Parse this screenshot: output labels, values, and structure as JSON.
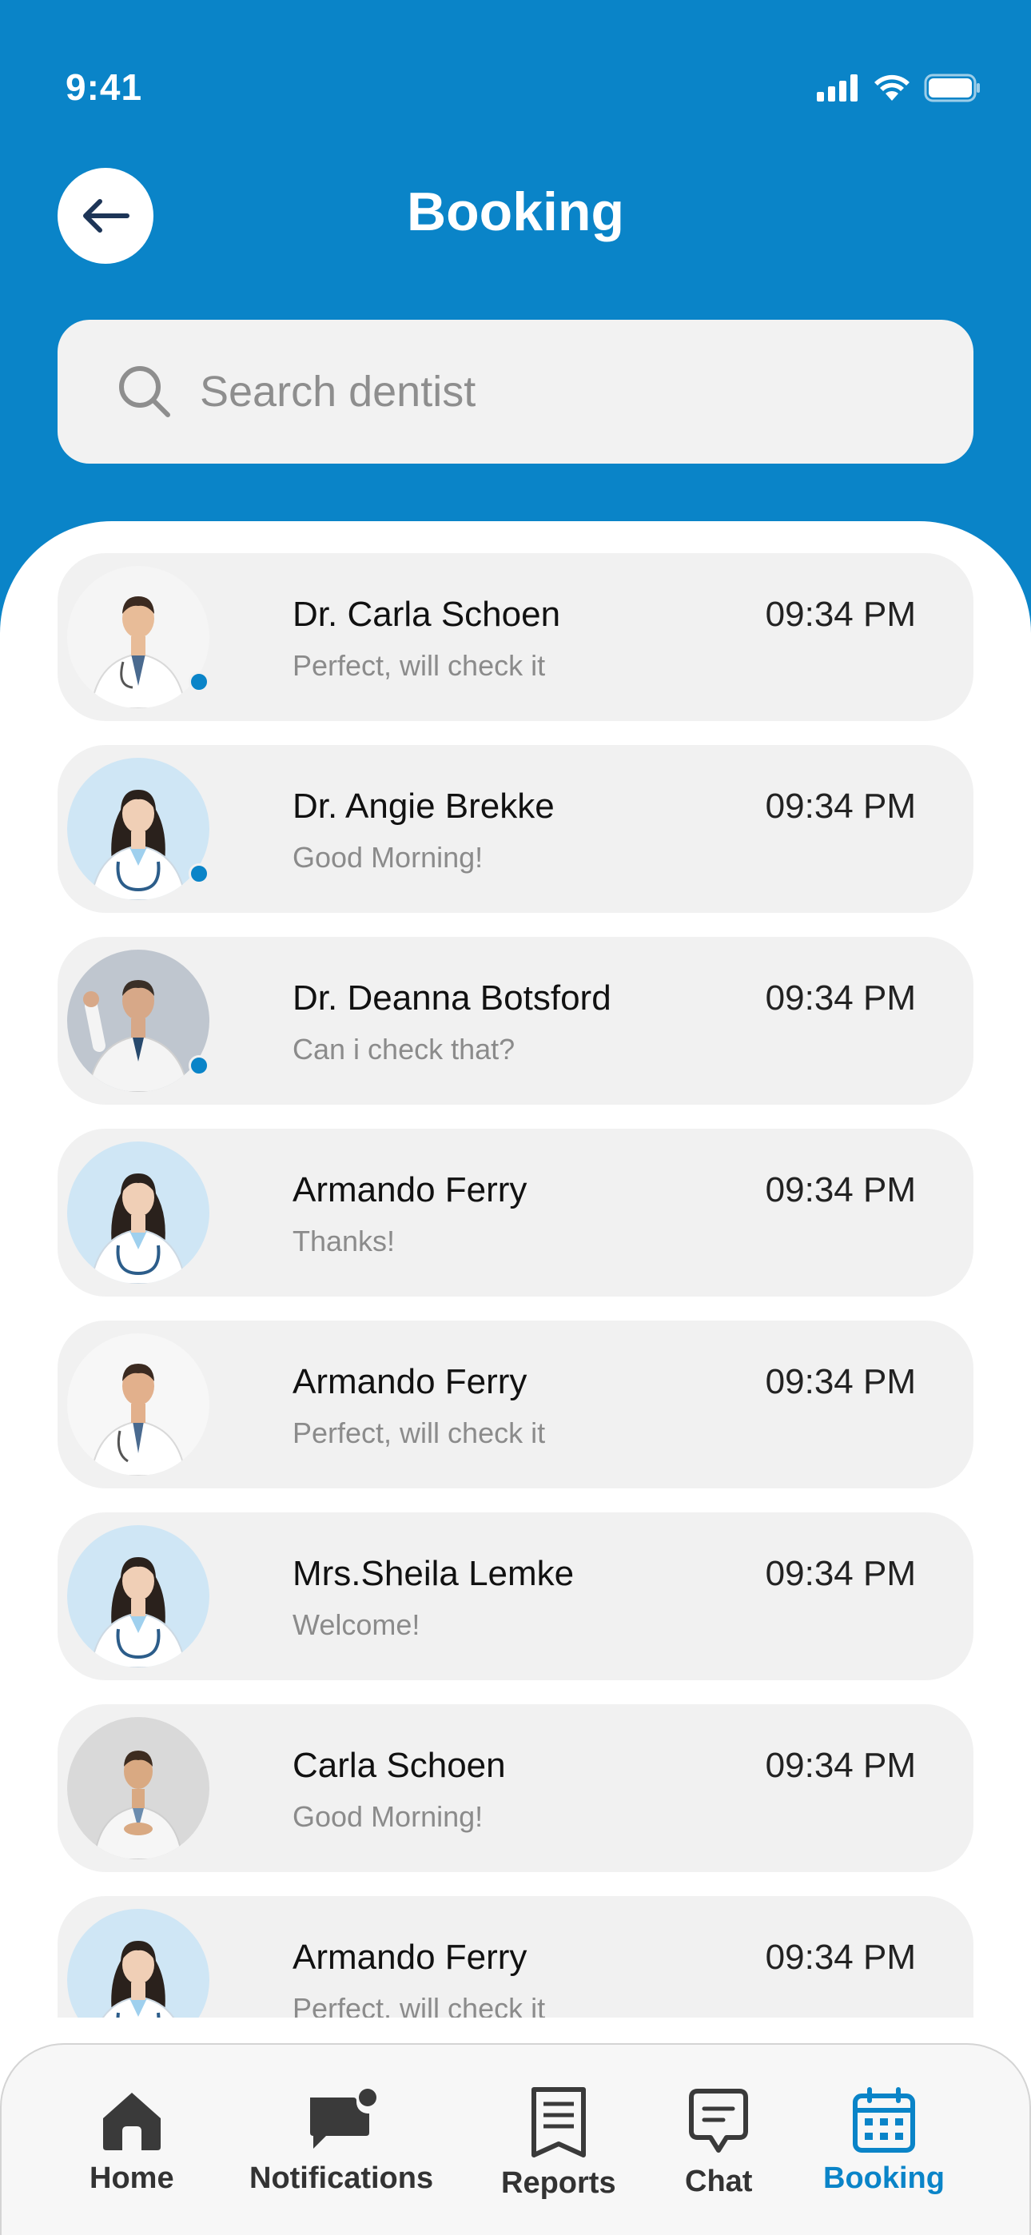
{
  "status_bar": {
    "time": "9:41"
  },
  "header": {
    "title": "Booking"
  },
  "search": {
    "placeholder": "Search dentist"
  },
  "chats": [
    {
      "name": "Dr. Carla Schoen",
      "message": "Perfect, will check it",
      "time": "09:34 PM",
      "online": true
    },
    {
      "name": "Dr. Angie Brekke",
      "message": "Good Morning!",
      "time": "09:34 PM",
      "online": true
    },
    {
      "name": "Dr. Deanna Botsford",
      "message": "Can i check that?",
      "time": "09:34 PM",
      "online": true
    },
    {
      "name": "Armando Ferry",
      "message": "Thanks!",
      "time": "09:34 PM",
      "online": false
    },
    {
      "name": "Armando Ferry",
      "message": "Perfect, will check it",
      "time": "09:34 PM",
      "online": false
    },
    {
      "name": "Mrs.Sheila Lemke",
      "message": "Welcome!",
      "time": "09:34 PM",
      "online": false
    },
    {
      "name": "Carla Schoen",
      "message": "Good Morning!",
      "time": "09:34 PM",
      "online": false
    },
    {
      "name": "Armando Ferry",
      "message": "Perfect, will check it",
      "time": "09:34 PM",
      "online": false
    }
  ],
  "nav": {
    "home": "Home",
    "notifications": "Notifications",
    "reports": "Reports",
    "chat": "Chat",
    "booking": "Booking",
    "active": "booking"
  },
  "colors": {
    "accent": "#0A84C8",
    "card": "#F1F1F1",
    "inactive_icon": "#3A3A3A"
  }
}
